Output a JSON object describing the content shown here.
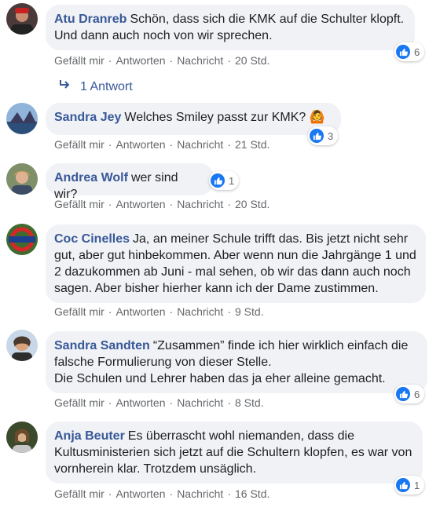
{
  "actions": {
    "like": "Gefällt mir",
    "reply": "Antworten",
    "message": "Nachricht",
    "sep": "·"
  },
  "replies_link": "1 Antwort",
  "comments": [
    {
      "name": "Atu Dranreb",
      "text": "Schön, dass sich die KMK auf die Schulter klopft. Und dann auch noch von wir sprechen.",
      "time": "20 Std.",
      "likes": "6"
    },
    {
      "name": "Sandra Jey",
      "text": "Welches Smiley passt zur KMK? 🙆",
      "time": "21 Std.",
      "likes": "3"
    },
    {
      "name": "Andrea Wolf",
      "text": "wer sind wir?",
      "time": "20 Std.",
      "likes": "1"
    },
    {
      "name": "Coc Cinelles",
      "text": "Ja, an meiner Schule trifft das. Bis jetzt nicht sehr gut, aber gut hinbekommen. Aber wenn nun die Jahrgänge 1 und 2 dazukommen ab Juni - mal sehen, ob wir das dann auch noch sagen. Aber bisher hierher kann ich der Dame zustimmen.",
      "time": "9 Std.",
      "likes": ""
    },
    {
      "name": "Sandra Sandten",
      "text": "“Zusammen” finde ich hier wirklich einfach die falsche Formulierung von dieser Stelle.\nDie Schulen und Lehrer haben das ja eher alleine gemacht.",
      "time": "8 Std.",
      "likes": "6"
    },
    {
      "name": "Anja Beuter",
      "text": "Es überrascht wohl niemanden, dass die Kultusministerien sich jetzt auf die Schultern klopfen, es war von vornherein klar. Trotzdem unsäglich.",
      "time": "16 Std.",
      "likes": "1"
    }
  ],
  "colors": {
    "name": "#385898",
    "bubble": "#f0f2f5",
    "like": "#1877f2",
    "meta": "#65676b"
  }
}
